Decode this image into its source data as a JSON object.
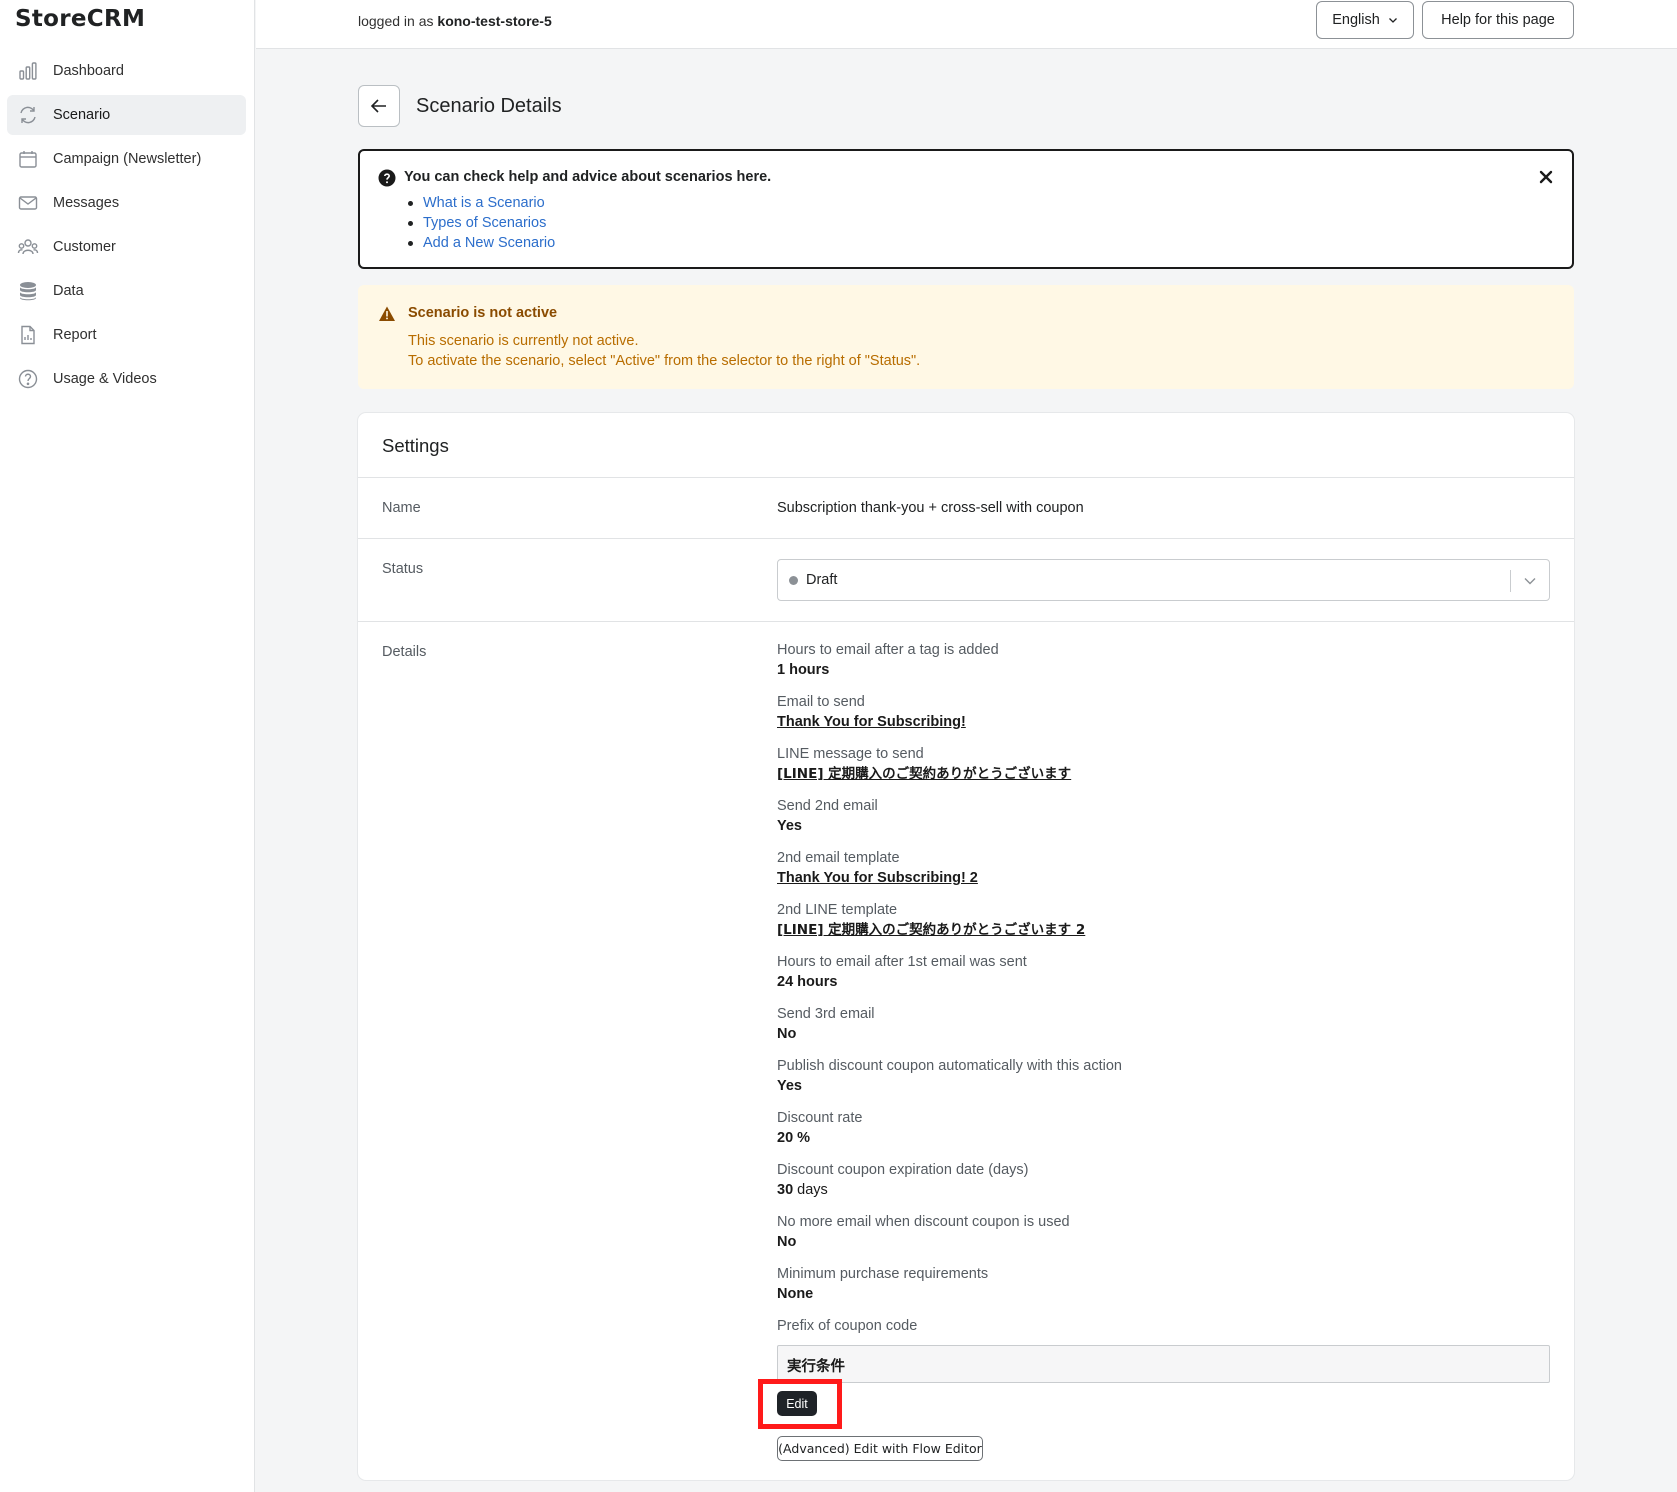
{
  "app": {
    "logo": "StoreCRM"
  },
  "sidebar": {
    "items": [
      {
        "label": "Dashboard",
        "icon": "bar-chart-icon"
      },
      {
        "label": "Scenario",
        "icon": "refresh-icon",
        "active": true
      },
      {
        "label": "Campaign (Newsletter)",
        "icon": "calendar-icon"
      },
      {
        "label": "Messages",
        "icon": "mail-icon"
      },
      {
        "label": "Customer",
        "icon": "users-icon"
      },
      {
        "label": "Data",
        "icon": "database-icon"
      },
      {
        "label": "Report",
        "icon": "report-icon"
      },
      {
        "label": "Usage & Videos",
        "icon": "question-icon"
      }
    ]
  },
  "topbar": {
    "logged_prefix": "logged in as ",
    "store": "kono-test-store-5",
    "language": "English",
    "help": "Help for this page"
  },
  "page": {
    "title": "Scenario Details"
  },
  "help_box": {
    "title": "You can check help and advice about scenarios here.",
    "links": [
      "What is a Scenario",
      "Types of Scenarios",
      "Add a New Scenario"
    ]
  },
  "warning": {
    "title": "Scenario is not active",
    "line1": "This scenario is currently not active.",
    "line2": "To activate the scenario, select \"Active\" from the selector to the right of \"Status\"."
  },
  "settings": {
    "title": "Settings",
    "name_label": "Name",
    "name_value": "Subscription thank-you + cross-sell with coupon",
    "status_label": "Status",
    "status_value": "Draft",
    "details_label": "Details",
    "details": [
      {
        "label": "Hours to email after a tag is added",
        "value": "1 hours"
      },
      {
        "label": "Email to send",
        "value": "Thank You for Subscribing!"
      },
      {
        "label": "LINE message to send",
        "value": "[LINE] 定期購入のご契約ありがとうございます"
      },
      {
        "label": "Send 2nd email",
        "value": "Yes"
      },
      {
        "label": "2nd email template",
        "value": "Thank You for Subscribing! 2"
      },
      {
        "label": "2nd LINE template",
        "value": "[LINE] 定期購入のご契約ありがとうございます 2"
      },
      {
        "label": "Hours to email after 1st email was sent",
        "value": "24 hours"
      },
      {
        "label": "Send 3rd email",
        "value": "No"
      },
      {
        "label": "Publish discount coupon automatically with this action",
        "value": "Yes"
      },
      {
        "label": "Discount rate",
        "value": "20 %"
      },
      {
        "label": "Discount coupon expiration date (days)",
        "value": "30",
        "unit": " days"
      },
      {
        "label": "No more email when discount coupon is used",
        "value": "No"
      },
      {
        "label": "Minimum purchase requirements",
        "value": "None"
      },
      {
        "label": "Prefix of coupon code",
        "value": ""
      }
    ],
    "prefix_value": "実行条件",
    "edit": "Edit",
    "flow_edit": "(Advanced) Edit with Flow Editor"
  },
  "colors": {
    "accent_link": "#2c6ecb",
    "warning_bg": "#fff8e5",
    "warning_text": "#b86d00",
    "highlight": "#ff1a1a",
    "dark_button": "#1f2328"
  }
}
